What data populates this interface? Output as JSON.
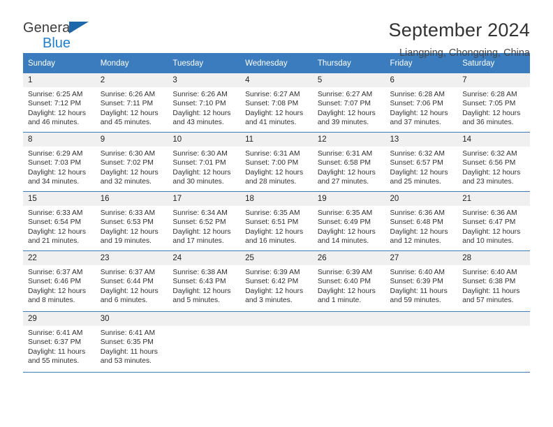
{
  "brand": {
    "line1": "General",
    "line2": "Blue",
    "triangle_color": "#1d68ab",
    "blue_text_color": "#1d7fd1"
  },
  "header": {
    "title": "September 2024",
    "subtitle": "Liangping, Chongqing, China"
  },
  "theme": {
    "header_row_bg": "#3a7cbe",
    "header_row_text": "#ffffff",
    "daynum_bg": "#f0f0f0",
    "grid_line": "#3a7cbe"
  },
  "calendar": {
    "weekday_headers": [
      "Sunday",
      "Monday",
      "Tuesday",
      "Wednesday",
      "Thursday",
      "Friday",
      "Saturday"
    ],
    "labels": {
      "sunrise_prefix": "Sunrise:",
      "sunset_prefix": "Sunset:",
      "daylight_prefix": "Daylight:"
    },
    "weeks": [
      [
        {
          "day": "1",
          "sunrise": "Sunrise: 6:25 AM",
          "sunset": "Sunset: 7:12 PM",
          "daylight1": "Daylight: 12 hours",
          "daylight2": "and 46 minutes."
        },
        {
          "day": "2",
          "sunrise": "Sunrise: 6:26 AM",
          "sunset": "Sunset: 7:11 PM",
          "daylight1": "Daylight: 12 hours",
          "daylight2": "and 45 minutes."
        },
        {
          "day": "3",
          "sunrise": "Sunrise: 6:26 AM",
          "sunset": "Sunset: 7:10 PM",
          "daylight1": "Daylight: 12 hours",
          "daylight2": "and 43 minutes."
        },
        {
          "day": "4",
          "sunrise": "Sunrise: 6:27 AM",
          "sunset": "Sunset: 7:08 PM",
          "daylight1": "Daylight: 12 hours",
          "daylight2": "and 41 minutes."
        },
        {
          "day": "5",
          "sunrise": "Sunrise: 6:27 AM",
          "sunset": "Sunset: 7:07 PM",
          "daylight1": "Daylight: 12 hours",
          "daylight2": "and 39 minutes."
        },
        {
          "day": "6",
          "sunrise": "Sunrise: 6:28 AM",
          "sunset": "Sunset: 7:06 PM",
          "daylight1": "Daylight: 12 hours",
          "daylight2": "and 37 minutes."
        },
        {
          "day": "7",
          "sunrise": "Sunrise: 6:28 AM",
          "sunset": "Sunset: 7:05 PM",
          "daylight1": "Daylight: 12 hours",
          "daylight2": "and 36 minutes."
        }
      ],
      [
        {
          "day": "8",
          "sunrise": "Sunrise: 6:29 AM",
          "sunset": "Sunset: 7:03 PM",
          "daylight1": "Daylight: 12 hours",
          "daylight2": "and 34 minutes."
        },
        {
          "day": "9",
          "sunrise": "Sunrise: 6:30 AM",
          "sunset": "Sunset: 7:02 PM",
          "daylight1": "Daylight: 12 hours",
          "daylight2": "and 32 minutes."
        },
        {
          "day": "10",
          "sunrise": "Sunrise: 6:30 AM",
          "sunset": "Sunset: 7:01 PM",
          "daylight1": "Daylight: 12 hours",
          "daylight2": "and 30 minutes."
        },
        {
          "day": "11",
          "sunrise": "Sunrise: 6:31 AM",
          "sunset": "Sunset: 7:00 PM",
          "daylight1": "Daylight: 12 hours",
          "daylight2": "and 28 minutes."
        },
        {
          "day": "12",
          "sunrise": "Sunrise: 6:31 AM",
          "sunset": "Sunset: 6:58 PM",
          "daylight1": "Daylight: 12 hours",
          "daylight2": "and 27 minutes."
        },
        {
          "day": "13",
          "sunrise": "Sunrise: 6:32 AM",
          "sunset": "Sunset: 6:57 PM",
          "daylight1": "Daylight: 12 hours",
          "daylight2": "and 25 minutes."
        },
        {
          "day": "14",
          "sunrise": "Sunrise: 6:32 AM",
          "sunset": "Sunset: 6:56 PM",
          "daylight1": "Daylight: 12 hours",
          "daylight2": "and 23 minutes."
        }
      ],
      [
        {
          "day": "15",
          "sunrise": "Sunrise: 6:33 AM",
          "sunset": "Sunset: 6:54 PM",
          "daylight1": "Daylight: 12 hours",
          "daylight2": "and 21 minutes."
        },
        {
          "day": "16",
          "sunrise": "Sunrise: 6:33 AM",
          "sunset": "Sunset: 6:53 PM",
          "daylight1": "Daylight: 12 hours",
          "daylight2": "and 19 minutes."
        },
        {
          "day": "17",
          "sunrise": "Sunrise: 6:34 AM",
          "sunset": "Sunset: 6:52 PM",
          "daylight1": "Daylight: 12 hours",
          "daylight2": "and 17 minutes."
        },
        {
          "day": "18",
          "sunrise": "Sunrise: 6:35 AM",
          "sunset": "Sunset: 6:51 PM",
          "daylight1": "Daylight: 12 hours",
          "daylight2": "and 16 minutes."
        },
        {
          "day": "19",
          "sunrise": "Sunrise: 6:35 AM",
          "sunset": "Sunset: 6:49 PM",
          "daylight1": "Daylight: 12 hours",
          "daylight2": "and 14 minutes."
        },
        {
          "day": "20",
          "sunrise": "Sunrise: 6:36 AM",
          "sunset": "Sunset: 6:48 PM",
          "daylight1": "Daylight: 12 hours",
          "daylight2": "and 12 minutes."
        },
        {
          "day": "21",
          "sunrise": "Sunrise: 6:36 AM",
          "sunset": "Sunset: 6:47 PM",
          "daylight1": "Daylight: 12 hours",
          "daylight2": "and 10 minutes."
        }
      ],
      [
        {
          "day": "22",
          "sunrise": "Sunrise: 6:37 AM",
          "sunset": "Sunset: 6:46 PM",
          "daylight1": "Daylight: 12 hours",
          "daylight2": "and 8 minutes."
        },
        {
          "day": "23",
          "sunrise": "Sunrise: 6:37 AM",
          "sunset": "Sunset: 6:44 PM",
          "daylight1": "Daylight: 12 hours",
          "daylight2": "and 6 minutes."
        },
        {
          "day": "24",
          "sunrise": "Sunrise: 6:38 AM",
          "sunset": "Sunset: 6:43 PM",
          "daylight1": "Daylight: 12 hours",
          "daylight2": "and 5 minutes."
        },
        {
          "day": "25",
          "sunrise": "Sunrise: 6:39 AM",
          "sunset": "Sunset: 6:42 PM",
          "daylight1": "Daylight: 12 hours",
          "daylight2": "and 3 minutes."
        },
        {
          "day": "26",
          "sunrise": "Sunrise: 6:39 AM",
          "sunset": "Sunset: 6:40 PM",
          "daylight1": "Daylight: 12 hours",
          "daylight2": "and 1 minute."
        },
        {
          "day": "27",
          "sunrise": "Sunrise: 6:40 AM",
          "sunset": "Sunset: 6:39 PM",
          "daylight1": "Daylight: 11 hours",
          "daylight2": "and 59 minutes."
        },
        {
          "day": "28",
          "sunrise": "Sunrise: 6:40 AM",
          "sunset": "Sunset: 6:38 PM",
          "daylight1": "Daylight: 11 hours",
          "daylight2": "and 57 minutes."
        }
      ],
      [
        {
          "day": "29",
          "sunrise": "Sunrise: 6:41 AM",
          "sunset": "Sunset: 6:37 PM",
          "daylight1": "Daylight: 11 hours",
          "daylight2": "and 55 minutes."
        },
        {
          "day": "30",
          "sunrise": "Sunrise: 6:41 AM",
          "sunset": "Sunset: 6:35 PM",
          "daylight1": "Daylight: 11 hours",
          "daylight2": "and 53 minutes."
        },
        {
          "day": "",
          "sunrise": "",
          "sunset": "",
          "daylight1": "",
          "daylight2": ""
        },
        {
          "day": "",
          "sunrise": "",
          "sunset": "",
          "daylight1": "",
          "daylight2": ""
        },
        {
          "day": "",
          "sunrise": "",
          "sunset": "",
          "daylight1": "",
          "daylight2": ""
        },
        {
          "day": "",
          "sunrise": "",
          "sunset": "",
          "daylight1": "",
          "daylight2": ""
        },
        {
          "day": "",
          "sunrise": "",
          "sunset": "",
          "daylight1": "",
          "daylight2": ""
        }
      ]
    ]
  }
}
